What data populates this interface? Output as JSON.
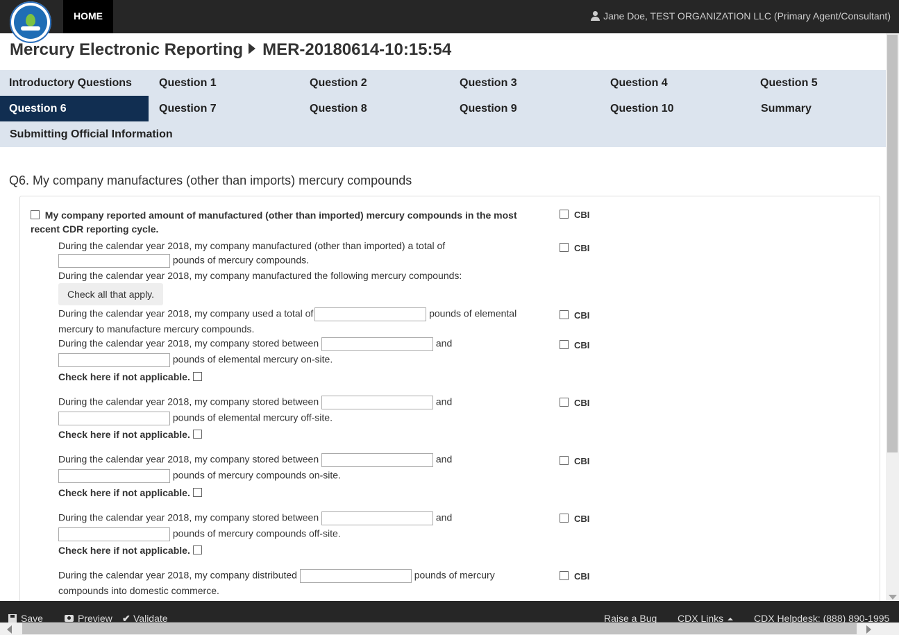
{
  "header": {
    "home_label": "HOME",
    "user_text": "Jane Doe, TEST ORGANIZATION LLC (Primary Agent/Consultant)"
  },
  "page": {
    "app_name": "Mercury Electronic Reporting",
    "report_id": "MER-20180614-10:15:54"
  },
  "nav": {
    "active": "Question 6",
    "items": [
      "Introductory Questions",
      "Question 1",
      "Question 2",
      "Question 3",
      "Question 4",
      "Question 5",
      "Question 6",
      "Question 7",
      "Question 8",
      "Question 9",
      "Question 10",
      "Summary",
      "Submitting Official Information"
    ]
  },
  "question": {
    "title": "Q6. My company manufactures (other than imports) mercury compounds",
    "main_checkbox_label": "My company reported amount of manufactured (other than imported) mercury compounds in the most recent CDR reporting cycle.",
    "cbi_label": "CBI",
    "na_label": "Check here if not applicable.",
    "and_label": "and",
    "manufactured_line1": "During the calendar year 2018, my company manufactured (other than imported) a total of",
    "manufactured_suffix": "pounds of mercury compounds.",
    "following_text": "During the calendar year 2018, my company manufactured the following mercury compounds:",
    "check_all_hint": "Check all that apply.",
    "used_prefix": "During the calendar year 2018, my company used a total of",
    "used_suffix1": "pounds of elemental",
    "used_suffix2": "mercury to manufacture mercury compounds.",
    "stored_prefix": "During the calendar year 2018, my company stored between",
    "stored_elemental_onsite": "pounds of elemental mercury on-site.",
    "stored_elemental_offsite": "pounds of elemental mercury off-site.",
    "stored_compounds_onsite": "pounds of mercury compounds on-site.",
    "stored_compounds_offsite": "pounds of mercury compounds off-site.",
    "distributed_prefix": "During the calendar year 2018, my company distributed",
    "distributed_suffix1": "pounds of mercury",
    "distributed_suffix2": "compounds into domestic commerce."
  },
  "footer": {
    "save": "Save",
    "preview": "Preview",
    "validate": "Validate",
    "raise_bug": "Raise a Bug",
    "cdx_links": "CDX Links",
    "helpdesk": "CDX Helpdesk: (888) 890-1995"
  }
}
